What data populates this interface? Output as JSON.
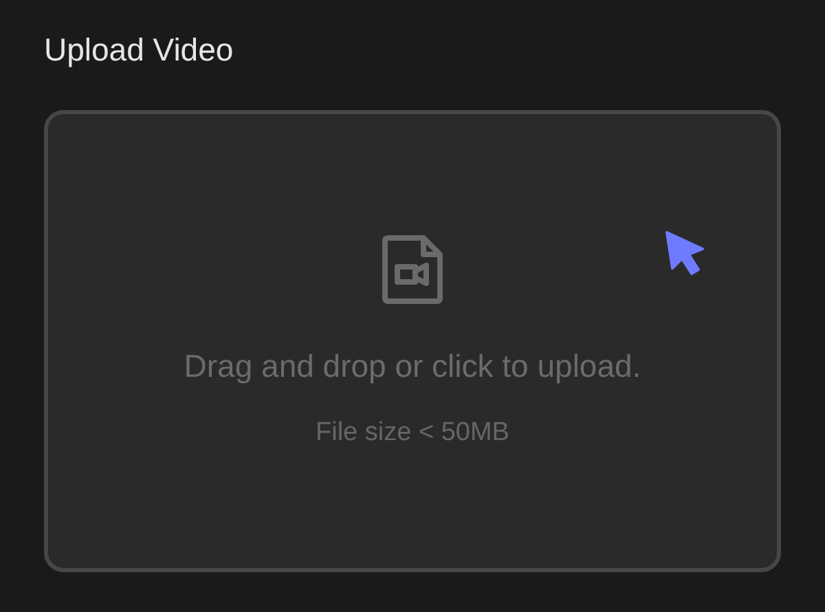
{
  "title": "Upload Video",
  "dropzone": {
    "prompt": "Drag and drop or click to upload.",
    "hint": "File size < 50MB"
  }
}
